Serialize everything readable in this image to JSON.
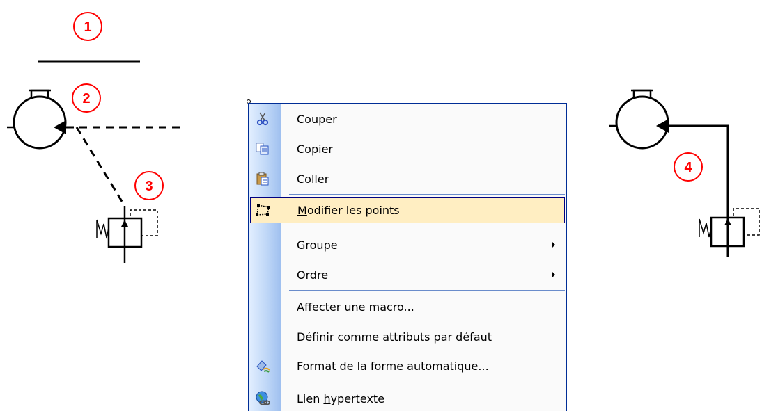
{
  "callouts": [
    "1",
    "2",
    "3",
    "4"
  ],
  "context_menu": {
    "items": [
      {
        "before": "",
        "accel": "C",
        "after": "ouper",
        "icon": "scissors-icon"
      },
      {
        "before": "Copi",
        "accel": "e",
        "after": "r",
        "icon": "copy-icon"
      },
      {
        "before": "C",
        "accel": "o",
        "after": "ller",
        "icon": "paste-icon"
      },
      {
        "before": "",
        "accel": "M",
        "after": "odifier les points",
        "icon": "edit-points-icon",
        "highlighted": true
      },
      {
        "before": "",
        "accel": "G",
        "after": "roupe",
        "submenu": true
      },
      {
        "before": "O",
        "accel": "r",
        "after": "dre",
        "submenu": true
      },
      {
        "before": "Affecter une ",
        "accel": "m",
        "after": "acro...",
        "icon": ""
      },
      {
        "before": "Déf",
        "accel": "i",
        "after": "nir comme attributs par défaut",
        "icon": ""
      },
      {
        "before": "",
        "accel": "F",
        "after": "ormat de la forme automatique...",
        "icon": "format-shape-icon"
      },
      {
        "before": "Lien ",
        "accel": "h",
        "after": "ypertexte",
        "icon": "hyperlink-globe-icon"
      }
    ]
  },
  "colors": {
    "callout": "#ff0000",
    "menu_border": "#002d96",
    "highlight": "#ffeec2"
  }
}
